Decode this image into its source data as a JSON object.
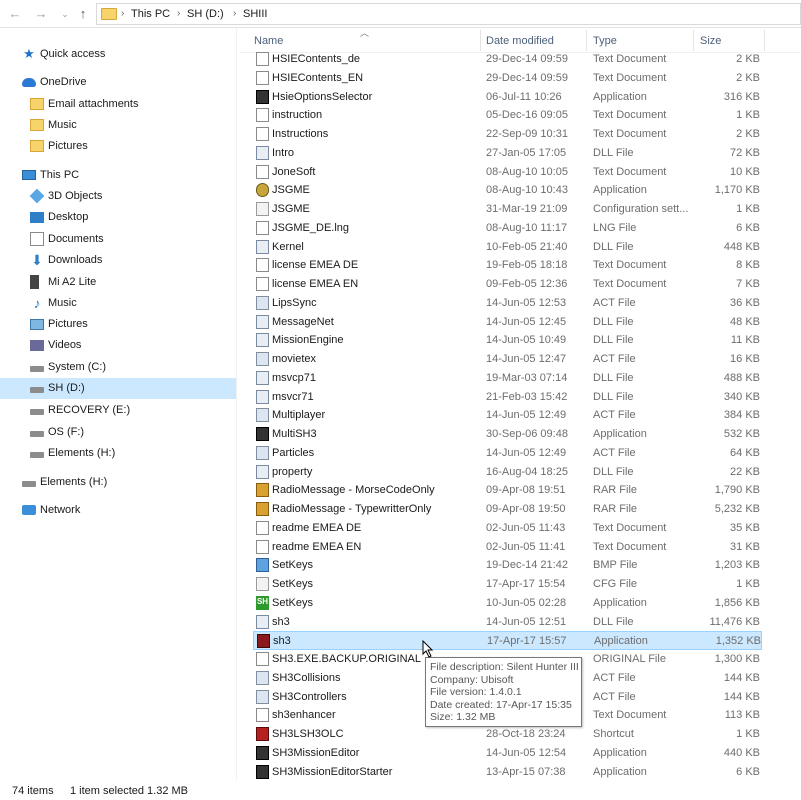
{
  "window": {
    "title": "SHIII"
  },
  "address": {
    "crumbs": [
      "This PC",
      "SH  (D:)",
      "SHIII"
    ]
  },
  "sidebar": {
    "items": [
      {
        "label": "Quick access",
        "icon": "star-icon"
      },
      {
        "label": "OneDrive",
        "icon": "cloud-icon"
      },
      {
        "label": "Email attachments",
        "icon": "folder-icon"
      },
      {
        "label": "Music",
        "icon": "folder-icon"
      },
      {
        "label": "Pictures",
        "icon": "folder-icon"
      },
      {
        "label": "This PC",
        "icon": "pc-icon"
      },
      {
        "label": "3D Objects",
        "icon": "cube-icon"
      },
      {
        "label": "Desktop",
        "icon": "desktop-icon"
      },
      {
        "label": "Documents",
        "icon": "documents-icon"
      },
      {
        "label": "Downloads",
        "icon": "download-icon"
      },
      {
        "label": "Mi A2 Lite",
        "icon": "phone-icon"
      },
      {
        "label": "Music",
        "icon": "music-icon"
      },
      {
        "label": "Pictures",
        "icon": "pictures-icon"
      },
      {
        "label": "Videos",
        "icon": "videos-icon"
      },
      {
        "label": "System (C:)",
        "icon": "drive-icon"
      },
      {
        "label": "SH  (D:)",
        "icon": "drive-icon"
      },
      {
        "label": "RECOVERY (E:)",
        "icon": "drive-icon"
      },
      {
        "label": "OS (F:)",
        "icon": "drive-icon"
      },
      {
        "label": "Elements (H:)",
        "icon": "drive-icon"
      },
      {
        "label": "Elements (H:)",
        "icon": "drive-icon"
      },
      {
        "label": "Network",
        "icon": "network-icon"
      }
    ]
  },
  "columns": {
    "name": "Name",
    "date": "Date modified",
    "type": "Type",
    "size": "Size"
  },
  "files": [
    {
      "name": "HSIEContents_de",
      "date": "29-Dec-14 09:59",
      "type": "Text Document",
      "size": "2 KB",
      "icon": "txt"
    },
    {
      "name": "HSIEContents_EN",
      "date": "29-Dec-14 09:59",
      "type": "Text Document",
      "size": "2 KB",
      "icon": "txt"
    },
    {
      "name": "HsieOptionsSelector",
      "date": "06-Jul-11 10:26",
      "type": "Application",
      "size": "316 KB",
      "icon": "multi"
    },
    {
      "name": "instruction",
      "date": "05-Dec-16 09:05",
      "type": "Text Document",
      "size": "1 KB",
      "icon": "txt"
    },
    {
      "name": "Instructions",
      "date": "22-Sep-09 10:31",
      "type": "Text Document",
      "size": "2 KB",
      "icon": "txt"
    },
    {
      "name": "Intro",
      "date": "27-Jan-05 17:05",
      "type": "DLL File",
      "size": "72 KB",
      "icon": "dll"
    },
    {
      "name": "JoneSoft",
      "date": "08-Aug-10 10:05",
      "type": "Text Document",
      "size": "10 KB",
      "icon": "txt"
    },
    {
      "name": "JSGME",
      "date": "08-Aug-10 10:43",
      "type": "Application",
      "size": "1,170 KB",
      "icon": "gear"
    },
    {
      "name": "JSGME",
      "date": "31-Mar-19 21:09",
      "type": "Configuration sett...",
      "size": "1 KB",
      "icon": "cfg"
    },
    {
      "name": "JSGME_DE.lng",
      "date": "08-Aug-10 11:17",
      "type": "LNG File",
      "size": "6 KB",
      "icon": "txt"
    },
    {
      "name": "Kernel",
      "date": "10-Feb-05 21:40",
      "type": "DLL File",
      "size": "448 KB",
      "icon": "dll"
    },
    {
      "name": "license EMEA DE",
      "date": "19-Feb-05 18:18",
      "type": "Text Document",
      "size": "8 KB",
      "icon": "txt"
    },
    {
      "name": "license EMEA EN",
      "date": "09-Feb-05 12:36",
      "type": "Text Document",
      "size": "7 KB",
      "icon": "txt"
    },
    {
      "name": "LipsSync",
      "date": "14-Jun-05 12:53",
      "type": "ACT File",
      "size": "36 KB",
      "icon": "act"
    },
    {
      "name": "MessageNet",
      "date": "14-Jun-05 12:45",
      "type": "DLL File",
      "size": "48 KB",
      "icon": "dll"
    },
    {
      "name": "MissionEngine",
      "date": "14-Jun-05 10:49",
      "type": "DLL File",
      "size": "11 KB",
      "icon": "dll"
    },
    {
      "name": "movietex",
      "date": "14-Jun-05 12:47",
      "type": "ACT File",
      "size": "16 KB",
      "icon": "act"
    },
    {
      "name": "msvcp71",
      "date": "19-Mar-03 07:14",
      "type": "DLL File",
      "size": "488 KB",
      "icon": "dll"
    },
    {
      "name": "msvcr71",
      "date": "21-Feb-03 15:42",
      "type": "DLL File",
      "size": "340 KB",
      "icon": "dll"
    },
    {
      "name": "Multiplayer",
      "date": "14-Jun-05 12:49",
      "type": "ACT File",
      "size": "384 KB",
      "icon": "act"
    },
    {
      "name": "MultiSH3",
      "date": "30-Sep-06 09:48",
      "type": "Application",
      "size": "532 KB",
      "icon": "multi"
    },
    {
      "name": "Particles",
      "date": "14-Jun-05 12:49",
      "type": "ACT File",
      "size": "64 KB",
      "icon": "act"
    },
    {
      "name": "property",
      "date": "16-Aug-04 18:25",
      "type": "DLL File",
      "size": "22 KB",
      "icon": "dll"
    },
    {
      "name": "RadioMessage - MorseCodeOnly",
      "date": "09-Apr-08 19:51",
      "type": "RAR File",
      "size": "1,790 KB",
      "icon": "rar"
    },
    {
      "name": "RadioMessage - TypewritterOnly",
      "date": "09-Apr-08 19:50",
      "type": "RAR File",
      "size": "5,232 KB",
      "icon": "rar"
    },
    {
      "name": "readme EMEA DE",
      "date": "02-Jun-05 11:43",
      "type": "Text Document",
      "size": "35 KB",
      "icon": "txt"
    },
    {
      "name": "readme EMEA EN",
      "date": "02-Jun-05 11:41",
      "type": "Text Document",
      "size": "31 KB",
      "icon": "txt"
    },
    {
      "name": "SetKeys",
      "date": "19-Dec-14 21:42",
      "type": "BMP File",
      "size": "1,203 KB",
      "icon": "bmp"
    },
    {
      "name": "SetKeys",
      "date": "17-Apr-17 15:54",
      "type": "CFG File",
      "size": "1 KB",
      "icon": "cfg"
    },
    {
      "name": "SetKeys",
      "date": "10-Jun-05 02:28",
      "type": "Application",
      "size": "1,856 KB",
      "icon": "sh"
    },
    {
      "name": "sh3",
      "date": "14-Jun-05 12:51",
      "type": "DLL File",
      "size": "11,476 KB",
      "icon": "dll"
    },
    {
      "name": "sh3",
      "date": "17-Apr-17 15:57",
      "type": "Application",
      "size": "1,352 KB",
      "icon": "app2",
      "selected": true
    },
    {
      "name": "SH3.EXE.BACKUP.ORIGINAL",
      "date": "",
      "type": "ORIGINAL File",
      "size": "1,300 KB",
      "icon": "txt"
    },
    {
      "name": "SH3Collisions",
      "date": "",
      "type": "ACT File",
      "size": "144 KB",
      "icon": "act"
    },
    {
      "name": "SH3Controllers",
      "date": "",
      "type": "ACT File",
      "size": "144 KB",
      "icon": "act"
    },
    {
      "name": "sh3enhancer",
      "date": "",
      "type": "Text Document",
      "size": "113 KB",
      "icon": "txt"
    },
    {
      "name": "SH3LSH3OLC",
      "date": "28-Oct-18 23:24",
      "type": "Shortcut",
      "size": "1 KB",
      "icon": "lnk"
    },
    {
      "name": "SH3MissionEditor",
      "date": "14-Jun-05 12:54",
      "type": "Application",
      "size": "440 KB",
      "icon": "multi"
    },
    {
      "name": "SH3MissionEditorStarter",
      "date": "13-Apr-15 07:38",
      "type": "Application",
      "size": "6 KB",
      "icon": "multi"
    }
  ],
  "tooltip": {
    "lines": [
      "File description: Silent Hunter III",
      "Company: Ubisoft",
      "File version: 1.4.0.1",
      "Date created: 17-Apr-17 15:35",
      "Size: 1.32 MB"
    ]
  },
  "status": {
    "items": "74 items",
    "selection": "1 item selected  1.32 MB"
  }
}
